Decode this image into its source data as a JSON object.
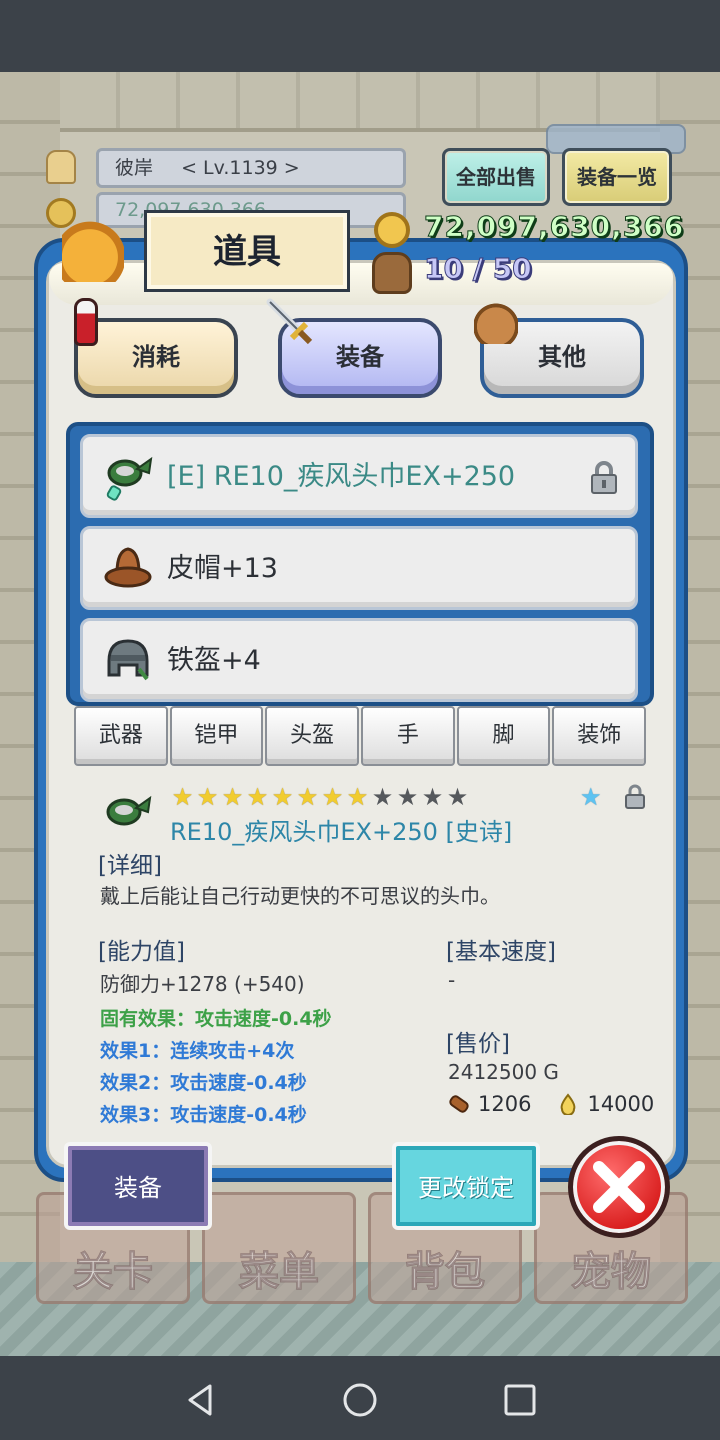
{
  "player": {
    "name": "彼岸",
    "level": "< Lv.1139 >",
    "gold_partial": "72,097,630,366"
  },
  "top_buttons": {
    "sell_all": "全部出售",
    "equip_list": "装备一览"
  },
  "panel": {
    "title": "道具",
    "gold": "72,097,630,366",
    "capacity": "10 / 50"
  },
  "categories": [
    {
      "label": "消耗",
      "icon": "potion-icon"
    },
    {
      "label": "装备",
      "icon": "sword-icon",
      "selected": true
    },
    {
      "label": "其他",
      "icon": "sack-icon"
    }
  ],
  "items": [
    {
      "name": "[E] RE10_疾风头巾EX+250",
      "icon": "green-bandana-icon",
      "locked": true,
      "selected": true
    },
    {
      "name": "皮帽+13",
      "icon": "leather-hat-icon"
    },
    {
      "name": "铁盔+4",
      "icon": "iron-helmet-icon"
    }
  ],
  "slot_tabs": [
    "武器",
    "铠甲",
    "头盔",
    "手",
    "脚",
    "装饰"
  ],
  "detail": {
    "stars_filled": 8,
    "stars_total": 12,
    "title": "RE10_疾风头巾EX+250 [史诗]",
    "detail_head": "[详细]",
    "description": "戴上后能让自己行动更快的不可思议的头巾。",
    "ability_head": "[能力值]",
    "defense": "防御力+1278 (+540)",
    "effects": [
      {
        "text": "固有效果：攻击速度-0.4秒",
        "color": "#3da148"
      },
      {
        "text": "效果1：连续攻击+4次",
        "color": "#2f7ad6"
      },
      {
        "text": "效果2：攻击速度-0.4秒",
        "color": "#2f7ad6"
      },
      {
        "text": "效果3：攻击速度-0.4秒",
        "color": "#2f7ad6"
      }
    ],
    "base_speed_head": "[基本速度]",
    "base_speed": "-",
    "price_head": "[售价]",
    "price_gold": "2412500 G",
    "price_wood": "1206",
    "price_drop": "14000"
  },
  "actions": {
    "equip": "装备",
    "change_lock": "更改锁定"
  },
  "menu": [
    "关卡",
    "菜单",
    "背包",
    "宠物"
  ],
  "colors": {
    "panel_blue": "#2b73bd",
    "gold_text": "#cfffc6",
    "effect_green": "#3da148",
    "effect_blue": "#2f7ad6",
    "close_red": "#d91e1e"
  }
}
